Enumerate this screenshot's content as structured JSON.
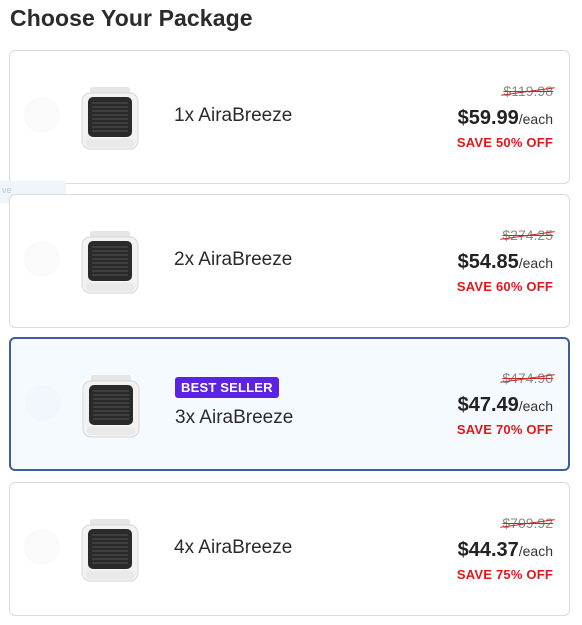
{
  "heading": "Choose Your Package",
  "overlay_fragment": "ve",
  "colors": {
    "accent_border": "#3a5f9c",
    "badge_bg": "#5b24e0",
    "save_red": "#e8141c",
    "selected_bg": "#f5faff"
  },
  "packages": [
    {
      "name": "1x AiraBreeze",
      "old_price": "$119.98",
      "price": "$59.99",
      "per": "/each",
      "save": "SAVE 50% OFF",
      "badge": ""
    },
    {
      "name": "2x AiraBreeze",
      "old_price": "$274.25",
      "price": "$54.85",
      "per": "/each",
      "save": "SAVE 60% OFF",
      "badge": ""
    },
    {
      "name": "3x AiraBreeze",
      "old_price": "$474.90",
      "price": "$47.49",
      "per": "/each",
      "save": "SAVE 70% OFF",
      "badge": "BEST SELLER",
      "selected": true
    },
    {
      "name": "4x AiraBreeze",
      "old_price": "$709.92",
      "price": "$44.37",
      "per": "/each",
      "save": "SAVE 75% OFF",
      "badge": ""
    }
  ]
}
